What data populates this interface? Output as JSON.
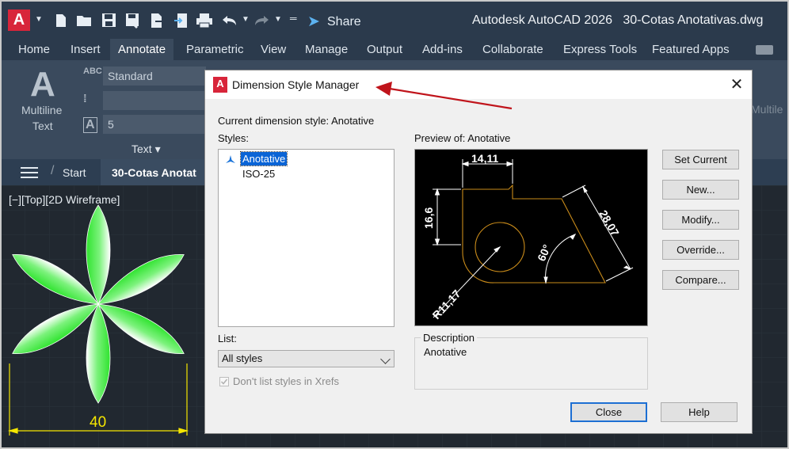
{
  "app": {
    "title": "Autodesk AutoCAD 2026",
    "filename": "30-Cotas Anotativas.dwg",
    "logo_letter": "A",
    "share_label": "Share"
  },
  "ribbon": {
    "tabs": [
      "Home",
      "Insert",
      "Annotate",
      "Parametric",
      "View",
      "Manage",
      "Output",
      "Add-ins",
      "Collaborate",
      "Express Tools",
      "Featured Apps"
    ],
    "active_tab": "Annotate",
    "multiline_text_line1": "Multiline",
    "multiline_text_line2": "Text",
    "text_style_value": "Standard",
    "text_height_value": "5",
    "abc_icon_label": "ABC",
    "panel_label": "Text ▾",
    "right_cut_label": "Multile"
  },
  "filebar": {
    "start_label": "Start",
    "file_tab_label": "30-Cotas Anotat"
  },
  "viewport": {
    "label": "[−][Top][2D Wireframe]",
    "dimension_value": "40"
  },
  "dialog": {
    "title": "Dimension Style Manager",
    "current_style_label": "Current dimension style: Anotative",
    "styles_label": "Styles:",
    "styles": [
      "Anotative",
      "ISO-25"
    ],
    "selected_style": "Anotative",
    "preview_label": "Preview of: Anotative",
    "list_label": "List:",
    "list_value": "All styles",
    "xref_checkbox_label": "Don't list styles in Xrefs",
    "description_title": "Description",
    "description_text": "Anotative",
    "buttons": {
      "set_current": "Set Current",
      "new": "New...",
      "modify": "Modify...",
      "override": "Override...",
      "compare": "Compare...",
      "close": "Close",
      "help": "Help"
    },
    "preview_dims": {
      "horizontal": "14,11",
      "vertical": "16,6",
      "aligned": "28,07",
      "angular": "60°",
      "radius": "R11,17"
    }
  },
  "colors": {
    "autocad_red": "#d8253a",
    "ribbon_dark": "#2b3a4c",
    "canvas_bg": "#212830",
    "petal_green": "#39e639",
    "dimension_yellow": "#f5e600",
    "preview_orange": "#c98b1a",
    "annotation_arrow": "#c0141b"
  }
}
